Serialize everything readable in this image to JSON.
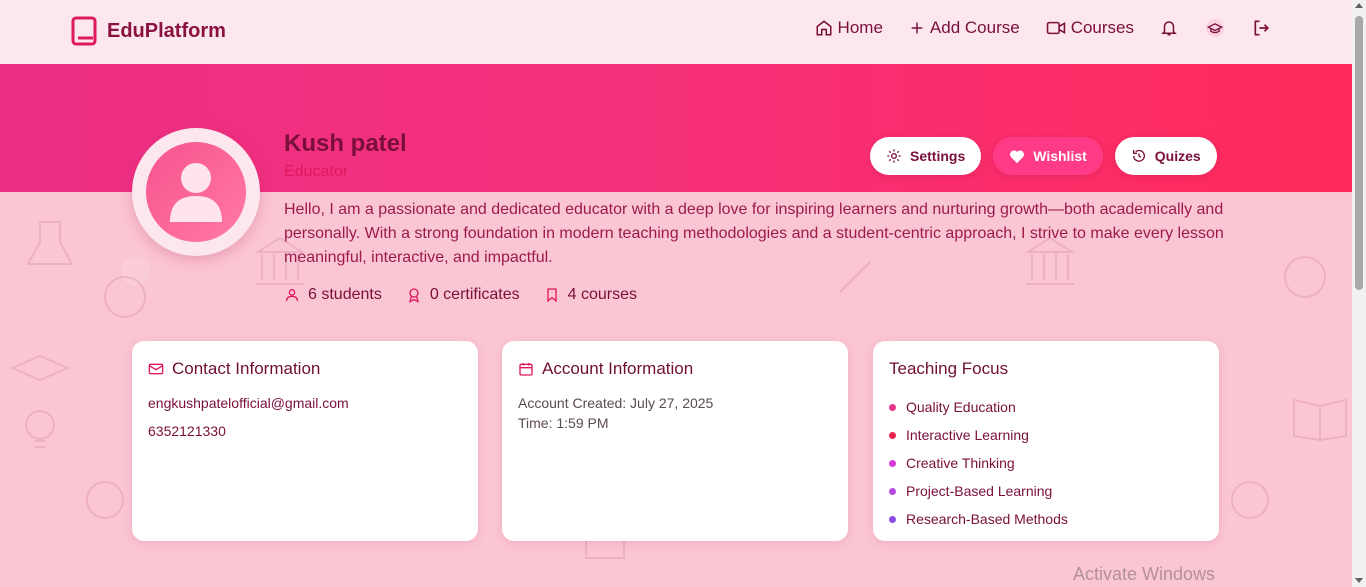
{
  "nav": {
    "brand": "EduPlatform",
    "links": [
      {
        "label": "Home",
        "icon": "home-icon"
      },
      {
        "label": "Add Course",
        "icon": "plus-icon"
      },
      {
        "label": "Courses",
        "icon": "video-icon"
      }
    ]
  },
  "profile": {
    "name": "Kush patel",
    "role": "Educator",
    "bio": "Hello, I am a passionate and dedicated educator with a deep love for inspiring learners and nurturing growth—both academically and personally. With a strong foundation in modern teaching methodologies and a student-centric approach, I strive to make every lesson meaningful, interactive, and impactful.",
    "stats": {
      "students": "6 students",
      "certificates": "0 certificates",
      "courses": "4 courses"
    }
  },
  "actions": {
    "settings": "Settings",
    "wishlist": "Wishlist",
    "quizes": "Quizes"
  },
  "contact": {
    "title": "Contact Information",
    "email": "engkushpatelofficial@gmail.com",
    "phone": "6352121330"
  },
  "account": {
    "title": "Account Information",
    "created": "Account Created: July 27, 2025",
    "time": "Time: 1:59 PM"
  },
  "teaching": {
    "title": "Teaching Focus",
    "items": [
      {
        "label": "Quality Education",
        "color": "#e6368b"
      },
      {
        "label": "Interactive Learning",
        "color": "#f0254f"
      },
      {
        "label": "Creative Thinking",
        "color": "#d63ad6"
      },
      {
        "label": "Project-Based Learning",
        "color": "#b64cdf"
      },
      {
        "label": "Research-Based Methods",
        "color": "#8b4ce6"
      }
    ]
  },
  "colors": {
    "accent": "#ff3b87",
    "hero_start": "#ec2f86",
    "hero_end": "#ff2a5a",
    "text": "#7a0f3a"
  },
  "watermark": "Activate Windows"
}
